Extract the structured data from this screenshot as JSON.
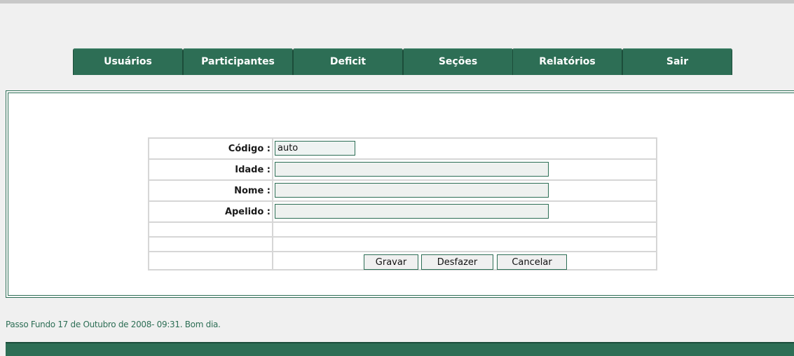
{
  "nav": {
    "tabs": [
      {
        "label": "Usuários"
      },
      {
        "label": "Participantes"
      },
      {
        "label": "Deficit"
      },
      {
        "label": "Seções"
      },
      {
        "label": "Relatórios"
      },
      {
        "label": "Sair"
      }
    ]
  },
  "form": {
    "codigo_label": "Código :",
    "codigo_value": "auto",
    "idade_label": "Idade :",
    "idade_value": "",
    "nome_label": "Nome :",
    "nome_value": "",
    "apelido_label": "Apelido :",
    "apelido_value": ""
  },
  "buttons": {
    "gravar": "Gravar",
    "desfazer": "Desfazer",
    "cancelar": "Cancelar"
  },
  "footer": {
    "status": "Passo Fundo 17 de Outubro de 2008- 09:31. Bom dia."
  },
  "colors": {
    "accent": "#2d6e55"
  }
}
